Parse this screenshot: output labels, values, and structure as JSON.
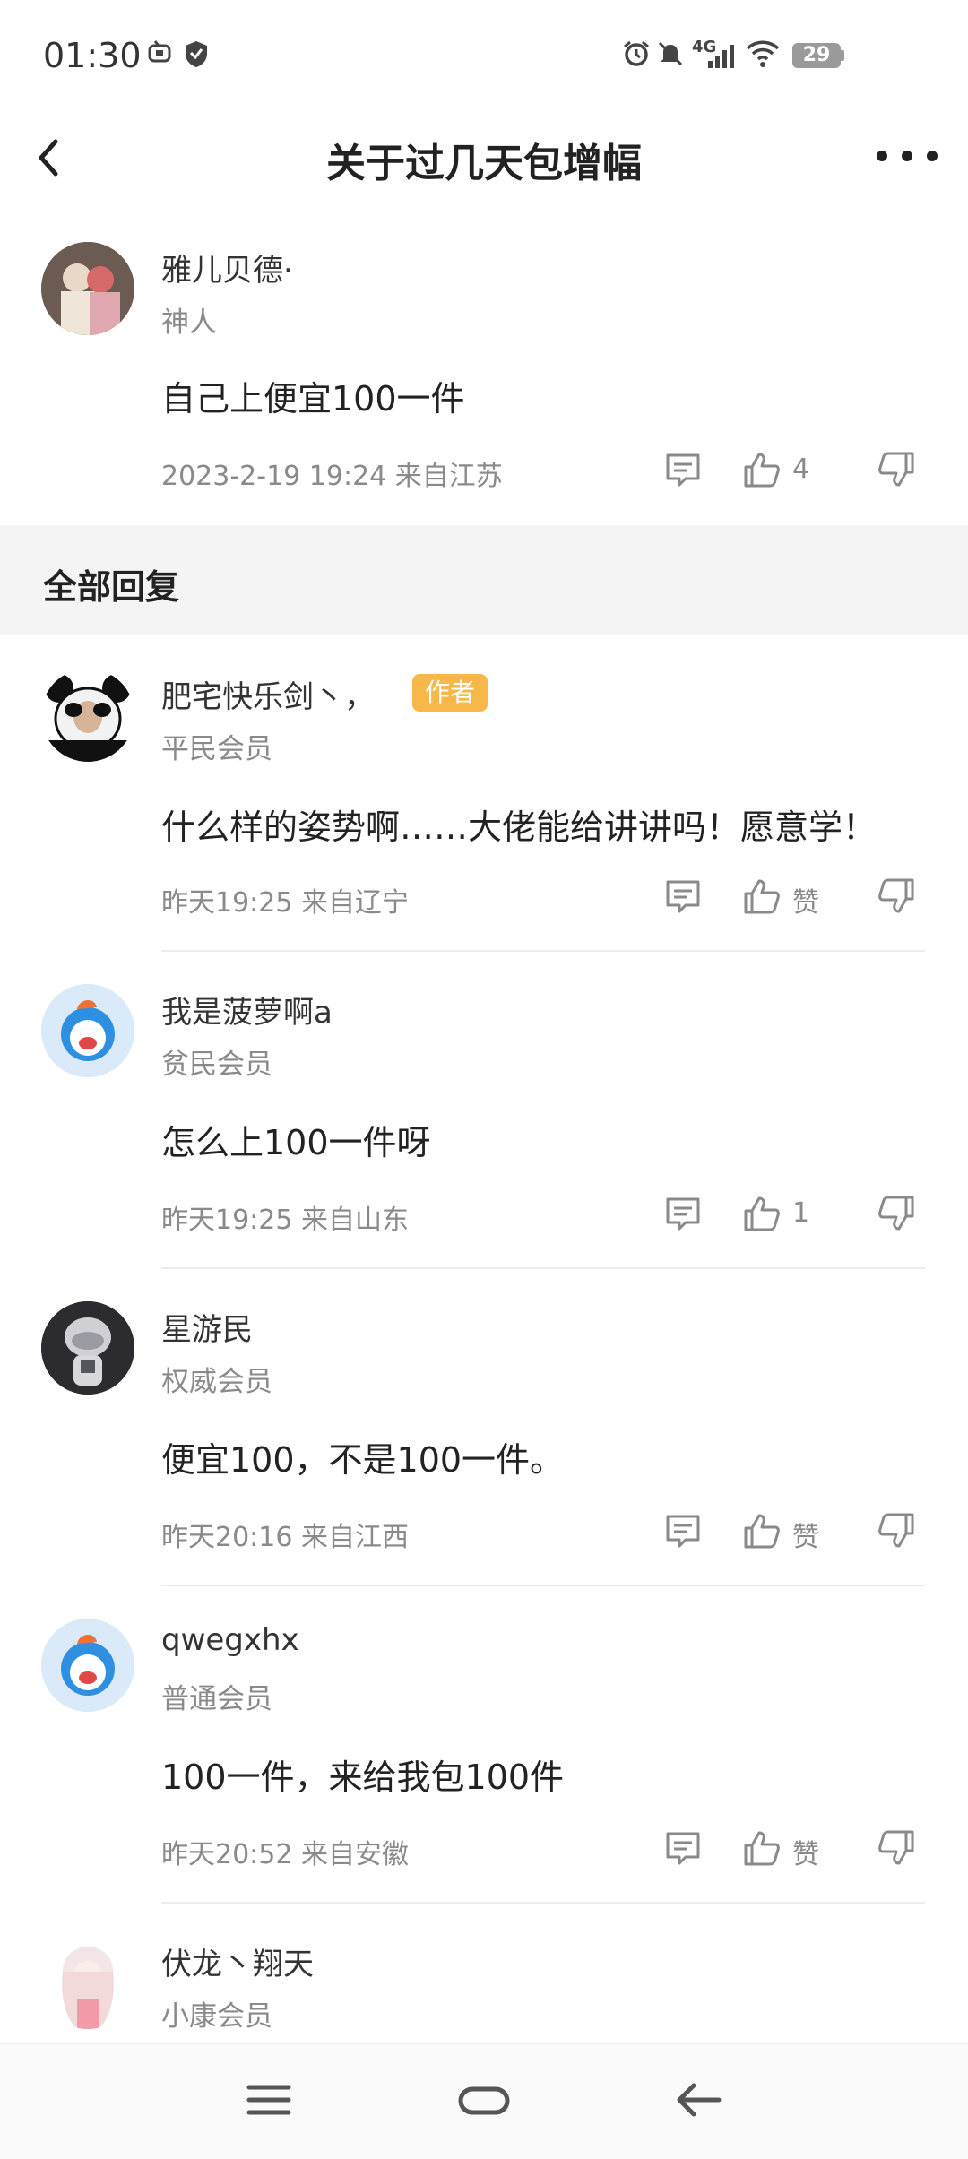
{
  "status_bar": {
    "time": "01:30",
    "network": "4G",
    "battery": "29"
  },
  "header": {
    "title": "关于过几天包增幅"
  },
  "post": {
    "username": "雅儿贝德·",
    "level": "神人",
    "content": "自己上便宜100一件",
    "timestamp": "2023-2-19 19:24  来自江苏",
    "likes": "4"
  },
  "replies_section": {
    "title": "全部回复"
  },
  "replies": [
    {
      "username": "肥宅快乐剑丶，",
      "badge": "作者",
      "level": "平民会员",
      "content": "什么样的姿势啊……大佬能给讲讲吗！愿意学！",
      "meta": "昨天19:25 来自辽宁",
      "like_label": "赞"
    },
    {
      "username": "我是菠萝啊a",
      "level": "贫民会员",
      "content": "怎么上100一件呀",
      "meta": "昨天19:25 来自山东",
      "like_label": "1"
    },
    {
      "username": "星游民",
      "level": "权威会员",
      "content": "便宜100，不是100一件。",
      "meta": "昨天20:16 来自江西",
      "like_label": "赞"
    },
    {
      "username": "qwegxhx",
      "level": "普通会员",
      "content": "100一件，来给我包100件",
      "meta": "昨天20:52 来自安徽",
      "like_label": "赞"
    },
    {
      "username": "伏龙丶翔天",
      "level": "小康会员"
    }
  ],
  "icons": {
    "back": "chevron-left-icon",
    "more": "more-dots-icon",
    "comment": "comment-icon",
    "like": "thumbs-up-icon",
    "dislike": "thumbs-down-icon",
    "menu": "menu-icon",
    "home": "home-pill-icon",
    "nav_back": "arrow-left-icon"
  }
}
